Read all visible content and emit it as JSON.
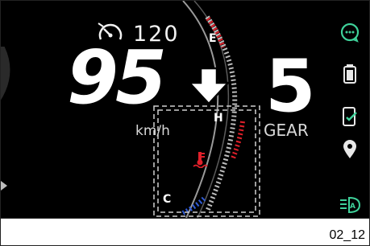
{
  "cluster": {
    "cruise_icon": "speedometer-limit-icon",
    "cruise_value": "120",
    "speed_value": "95",
    "speed_ghost": ")",
    "speed_unit": "km/h",
    "gear_value": "5",
    "gear_label": "GEAR"
  },
  "temperature_gauge": {
    "top_label": "E",
    "hot_label": "H",
    "cold_label": "C",
    "icon": "coolant-temperature-icon",
    "warning_color": "#e0202a",
    "cold_color": "#2f5bd8"
  },
  "pointer": {
    "icon": "down-arrow-icon"
  },
  "right_icons": [
    "chat-bubble-icon",
    "battery-icon",
    "phone-check-icon",
    "location-pin-icon",
    "auto-headlight-icon"
  ],
  "footer": {
    "caption": "02_12"
  }
}
